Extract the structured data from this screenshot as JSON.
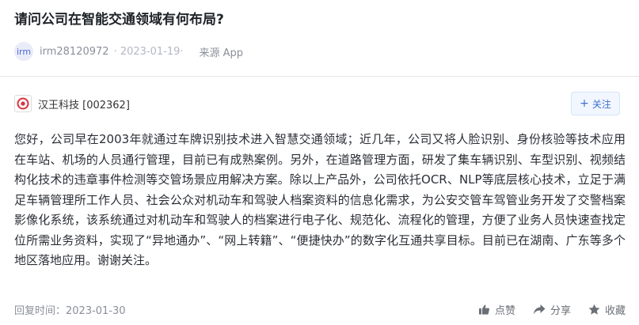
{
  "question": {
    "title": "请问公司在智能交通领域有何布局?"
  },
  "asker": {
    "avatar_text": "irm",
    "username": "irm28120972",
    "date_prefix": "· 2023-01-19·",
    "source": "来源 App"
  },
  "company": {
    "logo_icon": "company-logo-icon",
    "name": "汉王科技 [002362]",
    "follow_label": "关注"
  },
  "answer": {
    "text": "您好，公司早在2003年就通过车牌识别技术进入智慧交通领域；近几年，公司又将人脸识别、身份核验等技术应用在车站、机场的人员通行管理，目前已有成熟案例。另外，在道路管理方面，研发了集车辆识别、车型识别、视频结构化技术的违章事件检测等交管场景应用解决方案。除以上产品外，公司依托OCR、NLP等底层核心技术，立足于满足车辆管理所工作人员、社会公众对机动车和驾驶人档案资料的信息化需求，为公安交管车驾管业务开发了交警档案影像化系统，该系统通过对机动车和驾驶人的档案进行电子化、规范化、流程化的管理，方便了业务人员快速查找定位所需业务资料，实现了“异地通办”、“网上转籍”、“便捷快办”的数字化互通共享目标。目前已在湖南、广东等多个地区落地应用。谢谢关注。"
  },
  "footer": {
    "reply_time": "回复时间：2023-01-30",
    "like_label": "点赞",
    "share_label": "分享",
    "favorite_label": "收藏"
  },
  "colors": {
    "accent": "#3f6fd0",
    "logo_red": "#d9333f"
  }
}
